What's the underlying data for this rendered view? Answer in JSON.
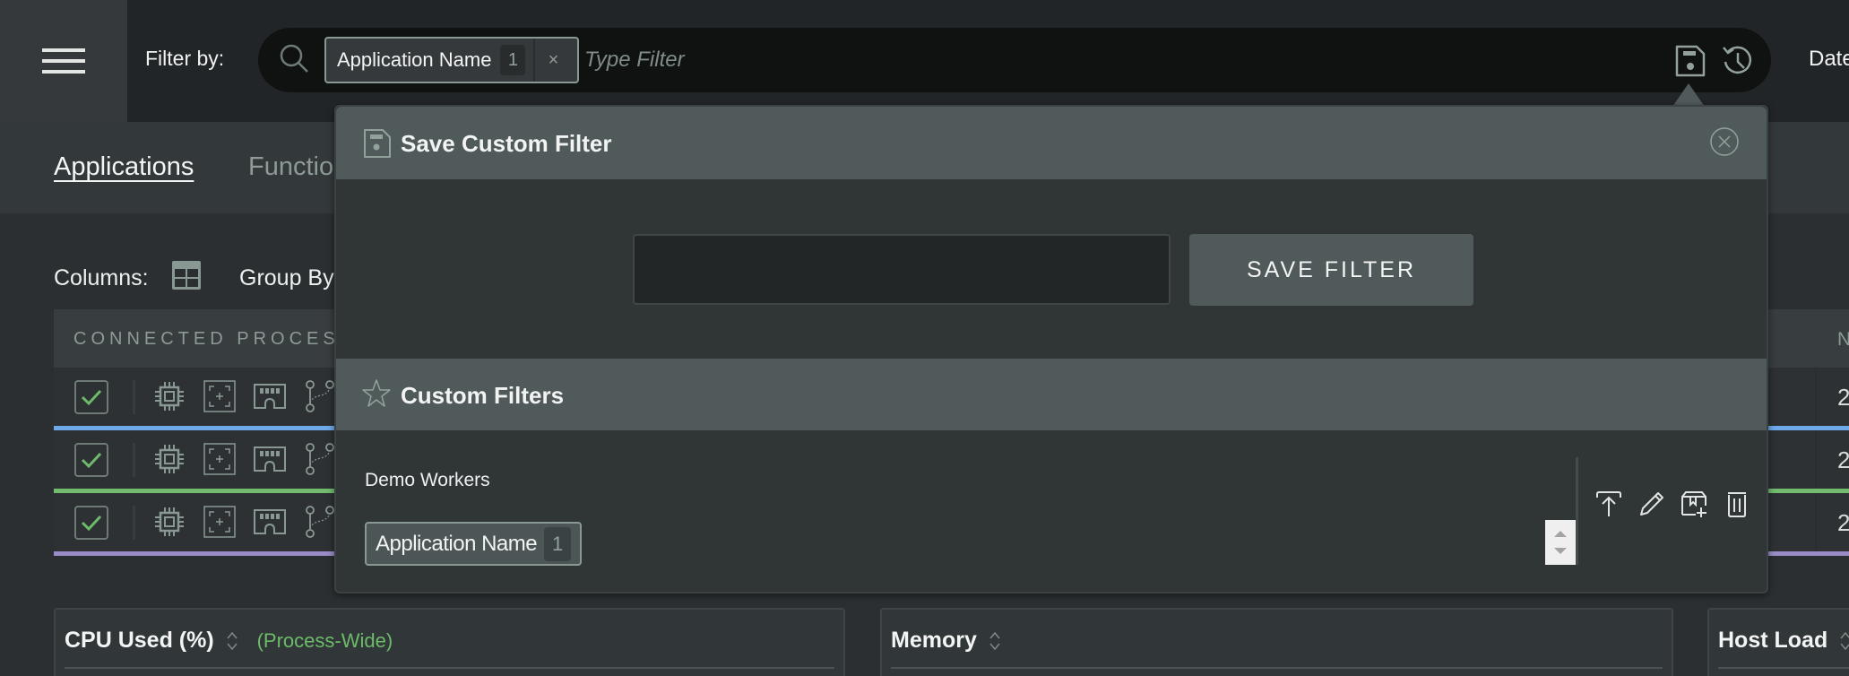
{
  "topbar": {
    "filter_label": "Filter by:",
    "active_filter": {
      "label": "Application Name",
      "count": "1",
      "remove_glyph": "×"
    },
    "search_placeholder": "Type Filter",
    "date_label": "Date",
    "icons": [
      "menu-icon",
      "search-icon",
      "save-icon",
      "history-icon"
    ]
  },
  "tabs": [
    {
      "label": "Applications",
      "active": true
    },
    {
      "label": "Functions",
      "active": false
    }
  ],
  "toolbar": {
    "columns_label": "Columns:",
    "group_by_label": "Group By"
  },
  "table": {
    "header": "CONNECTED PROCESSES",
    "right_header": "N",
    "rows": [
      {
        "checked": true,
        "value": "2",
        "color": "#6ea9ea"
      },
      {
        "checked": true,
        "value": "2",
        "color": "#72bb6f"
      },
      {
        "checked": true,
        "value": "2",
        "color": "#9a8cc6"
      }
    ],
    "row_icons": [
      "cpu-icon",
      "focus-icon",
      "memory-icon",
      "branch-icon"
    ]
  },
  "cards": [
    {
      "title": "CPU Used (%)",
      "subtitle": "(Process-Wide)"
    },
    {
      "title": "Memory",
      "subtitle": ""
    },
    {
      "title": "Host Load",
      "subtitle": ""
    }
  ],
  "popover": {
    "title": "Save Custom Filter",
    "name_input_value": "",
    "save_button_label": "SAVE FILTER",
    "custom_filters_title": "Custom Filters",
    "saved_filters": [
      {
        "name": "Demo Workers",
        "chip_label": "Application Name",
        "chip_count": "1"
      }
    ],
    "actions": [
      "apply-icon",
      "edit-icon",
      "overwrite-icon",
      "delete-icon"
    ]
  },
  "colors": {
    "accent_green": "#6dbb6a",
    "row_blue": "#6ea9ea",
    "row_green": "#72bb6f",
    "row_purple": "#9a8cc6"
  }
}
